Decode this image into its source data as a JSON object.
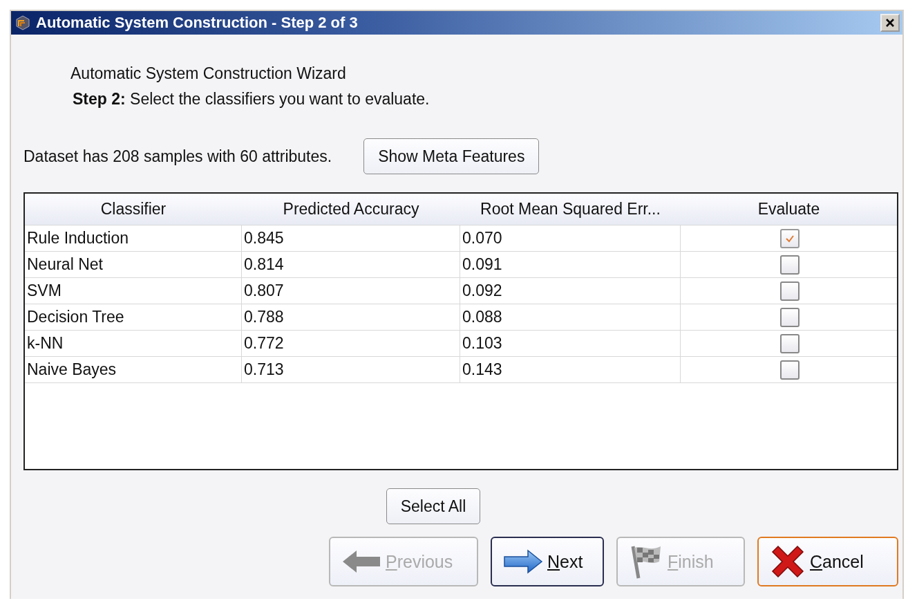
{
  "window": {
    "title": "Automatic System Construction - Step 2 of 3"
  },
  "header": {
    "title": "Automatic System Construction Wizard",
    "step_label": "Step 2:",
    "step_text": "Select the classifiers you want to evaluate."
  },
  "dataset_info": "Dataset has 208 samples with 60 attributes.",
  "meta_button": "Show Meta Features",
  "table": {
    "columns": [
      "Classifier",
      "Predicted Accuracy",
      "Root Mean Squared Err...",
      "Evaluate"
    ],
    "rows": [
      {
        "classifier": "Rule Induction",
        "accuracy": "0.845",
        "rmse": "0.070",
        "checked": true
      },
      {
        "classifier": "Neural Net",
        "accuracy": "0.814",
        "rmse": "0.091",
        "checked": false
      },
      {
        "classifier": "SVM",
        "accuracy": "0.807",
        "rmse": "0.092",
        "checked": false
      },
      {
        "classifier": "Decision Tree",
        "accuracy": "0.788",
        "rmse": "0.088",
        "checked": false
      },
      {
        "classifier": "k-NN",
        "accuracy": "0.772",
        "rmse": "0.103",
        "checked": false
      },
      {
        "classifier": "Naive Bayes",
        "accuracy": "0.713",
        "rmse": "0.143",
        "checked": false
      }
    ]
  },
  "select_all_button": "Select All",
  "buttons": [
    {
      "kind": "previous",
      "label": "Previous",
      "disabled": true,
      "focused": false,
      "hovered": false
    },
    {
      "kind": "next",
      "label": "Next",
      "disabled": false,
      "focused": true,
      "hovered": false
    },
    {
      "kind": "finish",
      "label": "Finish",
      "disabled": true,
      "focused": false,
      "hovered": false
    },
    {
      "kind": "cancel",
      "label": "Cancel",
      "disabled": false,
      "focused": false,
      "hovered": true
    }
  ]
}
